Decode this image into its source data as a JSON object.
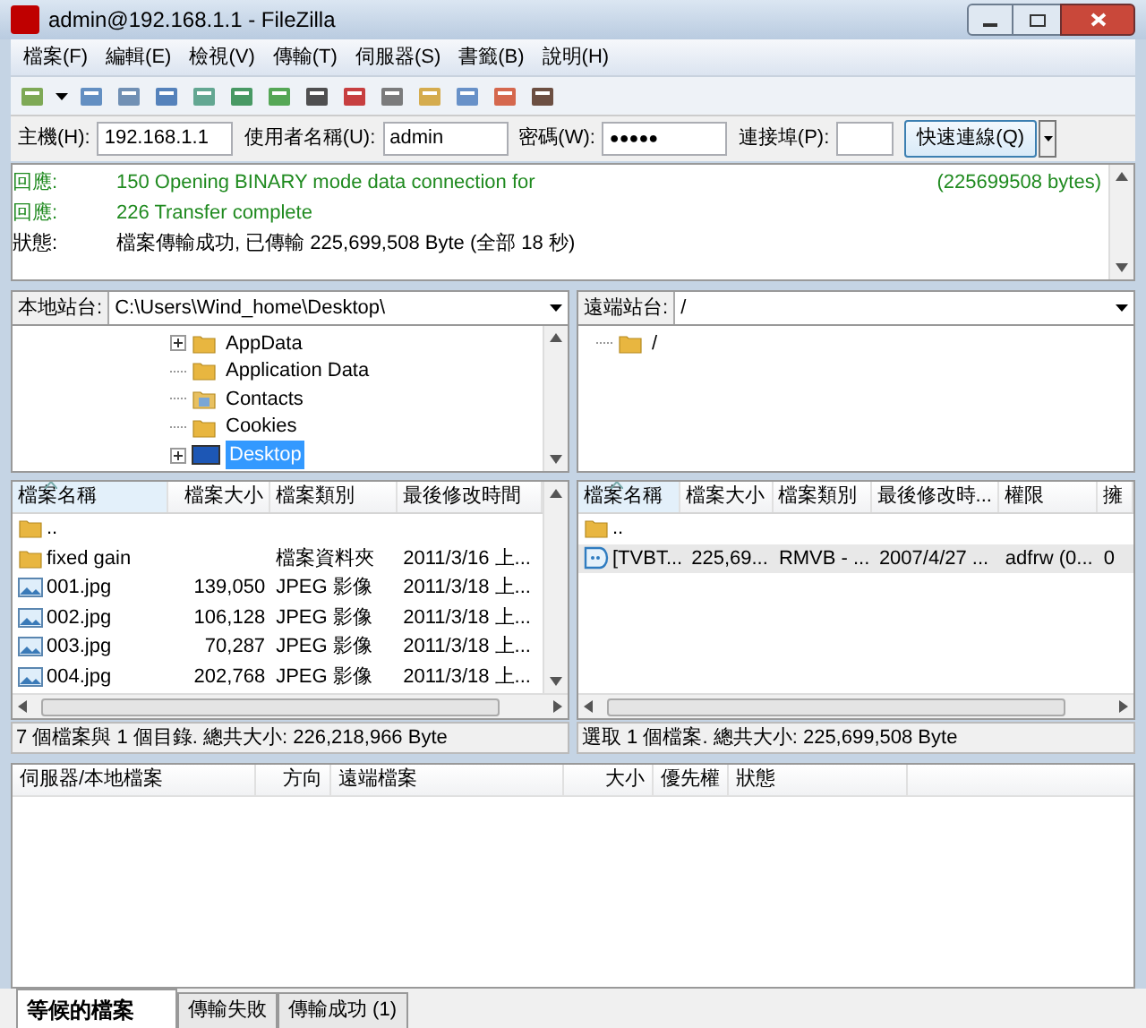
{
  "window": {
    "title": "admin@192.168.1.1 - FileZilla"
  },
  "menu": [
    "檔案(F)",
    "編輯(E)",
    "檢視(V)",
    "傳輸(T)",
    "伺服器(S)",
    "書籤(B)",
    "說明(H)"
  ],
  "quickconnect": {
    "fields": [
      {
        "label": "主機(H):",
        "value": "192.168.1.1",
        "kind": "text"
      },
      {
        "label": "使用者名稱(U):",
        "value": "admin",
        "kind": "text"
      },
      {
        "label": "密碼(W):",
        "value": "●●●●●",
        "kind": "password"
      },
      {
        "label": "連接埠(P):",
        "kind": "text"
      }
    ],
    "button": "快速連線(Q)"
  },
  "log": [
    {
      "label": "回應:",
      "text": "150 Opening BINARY mode data connection for",
      "right_text": "(225699508 bytes)",
      "kind": "response"
    },
    {
      "label": "回應:",
      "text": "226 Transfer complete",
      "kind": "response"
    },
    {
      "label": "狀態:",
      "text": "檔案傳輸成功, 已傳輸 225,699,508 Byte (全部 18 秒)",
      "kind": "status"
    }
  ],
  "local": {
    "site_label": "本地站台:",
    "path": "C:\\Users\\Wind_home\\Desktop\\",
    "tree": [
      {
        "name": "AppData",
        "kind": "folder",
        "expandable": true,
        "selected": false
      },
      {
        "name": "Application Data",
        "kind": "folder",
        "expandable": false,
        "selected": false
      },
      {
        "name": "Contacts",
        "kind": "contacts",
        "expandable": false,
        "selected": false
      },
      {
        "name": "Cookies",
        "kind": "folder",
        "expandable": false,
        "selected": false
      },
      {
        "name": "Desktop",
        "kind": "desktop",
        "expandable": true,
        "selected": true
      }
    ],
    "columns": [
      {
        "label": "檔案名稱",
        "sorted": true
      },
      {
        "label": "檔案大小",
        "sorted": false
      },
      {
        "label": "檔案類別",
        "sorted": false
      },
      {
        "label": "最後修改時間",
        "sorted": false
      }
    ],
    "rows": [
      {
        "kind": "folder",
        "selected": false,
        "cells": [
          "..",
          "",
          "",
          ""
        ]
      },
      {
        "kind": "folder",
        "selected": false,
        "cells": [
          "fixed gain",
          "",
          "檔案資料夾",
          "2011/3/16 上..."
        ]
      },
      {
        "kind": "image",
        "selected": false,
        "cells": [
          "001.jpg",
          "139,050",
          "JPEG 影像",
          "2011/3/18 上..."
        ]
      },
      {
        "kind": "image",
        "selected": false,
        "cells": [
          "002.jpg",
          "106,128",
          "JPEG 影像",
          "2011/3/18 上..."
        ]
      },
      {
        "kind": "image",
        "selected": false,
        "cells": [
          "003.jpg",
          "70,287",
          "JPEG 影像",
          "2011/3/18 上..."
        ]
      },
      {
        "kind": "image",
        "selected": false,
        "cells": [
          "004.jpg",
          "202,768",
          "JPEG 影像",
          "2011/3/18 上..."
        ]
      }
    ],
    "status": "7 個檔案與 1 個目錄. 總共大小: 226,218,966 Byte"
  },
  "remote": {
    "site_label": "遠端站台:",
    "path": "/",
    "tree": [
      {
        "name": "/",
        "kind": "folder",
        "expandable": false,
        "selected": false
      }
    ],
    "columns": [
      {
        "label": "檔案名稱",
        "sorted": true
      },
      {
        "label": "檔案大小",
        "sorted": false
      },
      {
        "label": "檔案類別",
        "sorted": false
      },
      {
        "label": "最後修改時...",
        "sorted": false
      },
      {
        "label": "權限",
        "sorted": false
      },
      {
        "label": "擁",
        "sorted": false
      }
    ],
    "rows": [
      {
        "kind": "folder",
        "selected": false,
        "cells": [
          "..",
          "",
          "",
          "",
          "",
          ""
        ]
      },
      {
        "kind": "media",
        "selected": true,
        "cells": [
          "[TVBT...",
          "225,69...",
          "RMVB - ...",
          "2007/4/27 ...",
          "adfrw (0...",
          "0"
        ]
      }
    ],
    "status": "選取 1 個檔案. 總共大小: 225,699,508 Byte"
  },
  "queue": {
    "columns": [
      "伺服器/本地檔案",
      "方向",
      "遠端檔案",
      "大小",
      "優先權",
      "狀態"
    ],
    "tabs": [
      {
        "label": "等候的檔案",
        "selected": true
      },
      {
        "label": "傳輸失敗",
        "selected": false
      },
      {
        "label": "傳輸成功 (1)",
        "selected": false
      }
    ]
  }
}
